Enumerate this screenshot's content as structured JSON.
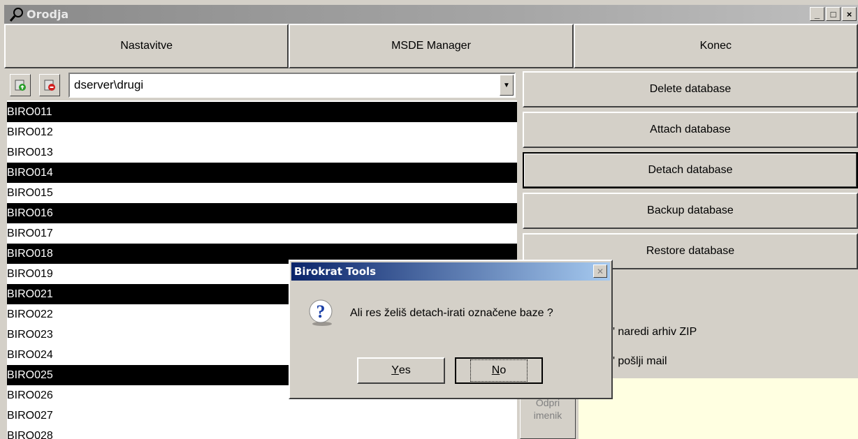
{
  "window": {
    "title": "Orodja",
    "controls": [
      "_",
      "□",
      "×"
    ]
  },
  "tabs": [
    {
      "label": "Nastavitve"
    },
    {
      "label": "MSDE Manager"
    },
    {
      "label": "Konec"
    }
  ],
  "server_combo": {
    "value": "dserver\\drugi"
  },
  "databases": [
    {
      "name": "BIRO011",
      "selected": true
    },
    {
      "name": "BIRO012",
      "selected": false
    },
    {
      "name": "BIRO013",
      "selected": false
    },
    {
      "name": "BIRO014",
      "selected": true
    },
    {
      "name": "BIRO015",
      "selected": false
    },
    {
      "name": "BIRO016",
      "selected": true
    },
    {
      "name": "BIRO017",
      "selected": false
    },
    {
      "name": "BIRO018",
      "selected": true
    },
    {
      "name": "BIRO019",
      "selected": false
    },
    {
      "name": "BIRO021",
      "selected": true
    },
    {
      "name": "BIRO022",
      "selected": false
    },
    {
      "name": "BIRO023",
      "selected": false
    },
    {
      "name": "BIRO024",
      "selected": false
    },
    {
      "name": "BIRO025",
      "selected": true
    },
    {
      "name": "BIRO026",
      "selected": false
    },
    {
      "name": "BIRO027",
      "selected": false
    },
    {
      "name": "BIRO028",
      "selected": false
    }
  ],
  "actions": {
    "delete": "Delete database",
    "attach": "Attach database",
    "detach": "Detach database",
    "backup": "Backup database",
    "restore": "Restore database"
  },
  "options": {
    "zip_label": "-u\" naredi arhiv ZIP",
    "mail_label": "-u\" pošlji mail"
  },
  "odpri_imenik": {
    "line1": "Odpri",
    "line2": "imenik"
  },
  "dialog": {
    "title": "Birokrat Tools",
    "message": "Ali res želiš detach-irati označene baze ?",
    "yes_label_pre": "",
    "yes_label_u": "Y",
    "yes_label_post": "es",
    "no_label_u": "N",
    "no_label_post": "o"
  }
}
